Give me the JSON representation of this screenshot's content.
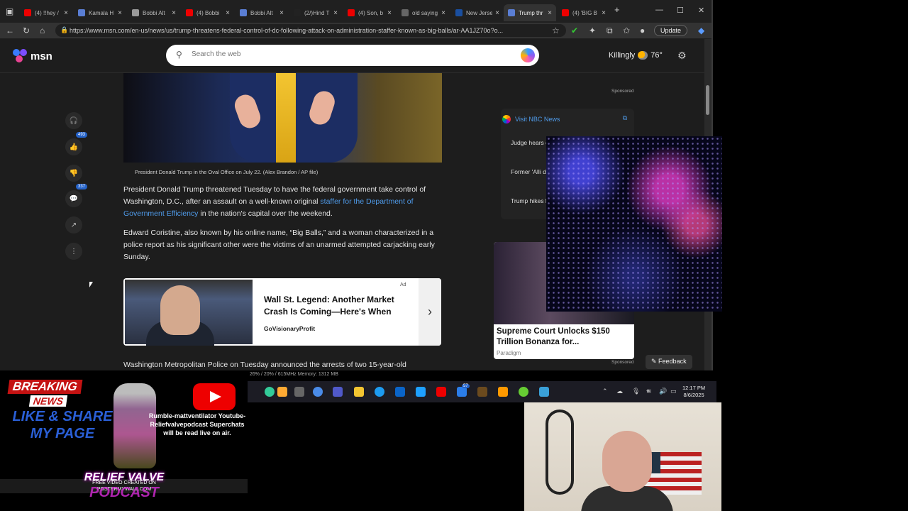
{
  "browser": {
    "tabs": [
      {
        "label": "(4) !!hey /",
        "fav": "#e00"
      },
      {
        "label": "Kamala H",
        "fav": "#5a7ed4"
      },
      {
        "label": "Bobbi Alt",
        "fav": "#999"
      },
      {
        "label": "(4) Bobbi",
        "fav": "#e00"
      },
      {
        "label": "Bobbi Alt",
        "fav": "#5a7ed4"
      },
      {
        "label": "(2/)Hind T",
        "fav": "#222"
      },
      {
        "label": "(4) Son, b",
        "fav": "#e00"
      },
      {
        "label": "old saying",
        "fav": "#666"
      },
      {
        "label": "New Jerse",
        "fav": "#1a4fa0"
      },
      {
        "label": "Trump thr",
        "fav": "#5a7ed4"
      },
      {
        "label": "(4) 'BIG B",
        "fav": "#e00"
      }
    ],
    "new_tab": "+",
    "url": "https://www.msn.com/en-us/news/us/trump-threatens-federal-control-of-dc-following-attack-on-administration-staffer-known-as-big-balls/ar-AA1JZ70o?o...",
    "update_label": "Update",
    "win_min": "—",
    "win_max": "☐",
    "win_close": "✕"
  },
  "msn": {
    "logo": "msn",
    "search_placeholder": "Search the web",
    "location": "Killingly",
    "temperature": "76°",
    "rail_like_count": "493",
    "rail_comment_count": "337",
    "caption": "President Donald Trump in the Oval Office on July 22. (Alex Brandon / AP file)",
    "para1_a": "President Donald Trump threatened Tuesday to have the federal government take control of Washington, D.C., after an assault on a well-known original ",
    "para1_link": "staffer for the Department of Government Efficiency",
    "para1_b": " in the nation's capital over the weekend.",
    "para2": "Edward Coristine, also known by his online name, “Big Balls,” and a woman characterized in a police report as his significant other were the victims of an unarmed attempted carjacking early Sunday.",
    "ad_label": "Ad",
    "ad_title": "Wall St. Legend: Another Market Crash Is Coming—Here's When",
    "ad_source": "GoVisionaryProfit",
    "bottom_text": "Washington Metropolitan Police on Tuesday announced the arrests of two 15-year-old",
    "sponsored": "Sponsored",
    "nbc_header": "Visit NBC News",
    "nbc_items": [
      "Judge hears environmen",
      "Former 'Alli describes 'in",
      "Trump hikes for buying R"
    ],
    "promo_title": "Supreme Court Unlocks $150 Trillion Bonanza for...",
    "promo_source": "Paradigm",
    "feedback": "Feedback"
  },
  "taskbar": {
    "perf": "26% / 20% / 615MHz        Memory:  1312 MB",
    "time": "12:17 PM",
    "date": "8/6/2025",
    "badge": "57"
  },
  "stream": {
    "breaking": "BREAKING",
    "news": "NEWS",
    "share": "LIKE & SHARE MY PAGE",
    "promo": "Rumble-mattventilator Youtube-Reliefvalvepodcast Superchats will be read live on air.",
    "brand": "RELIEF VALVE",
    "brand_credit": "FREE VIDEO CREATED ON POSTERMYWALL.COM",
    "brand_sub": "PODCAST"
  }
}
